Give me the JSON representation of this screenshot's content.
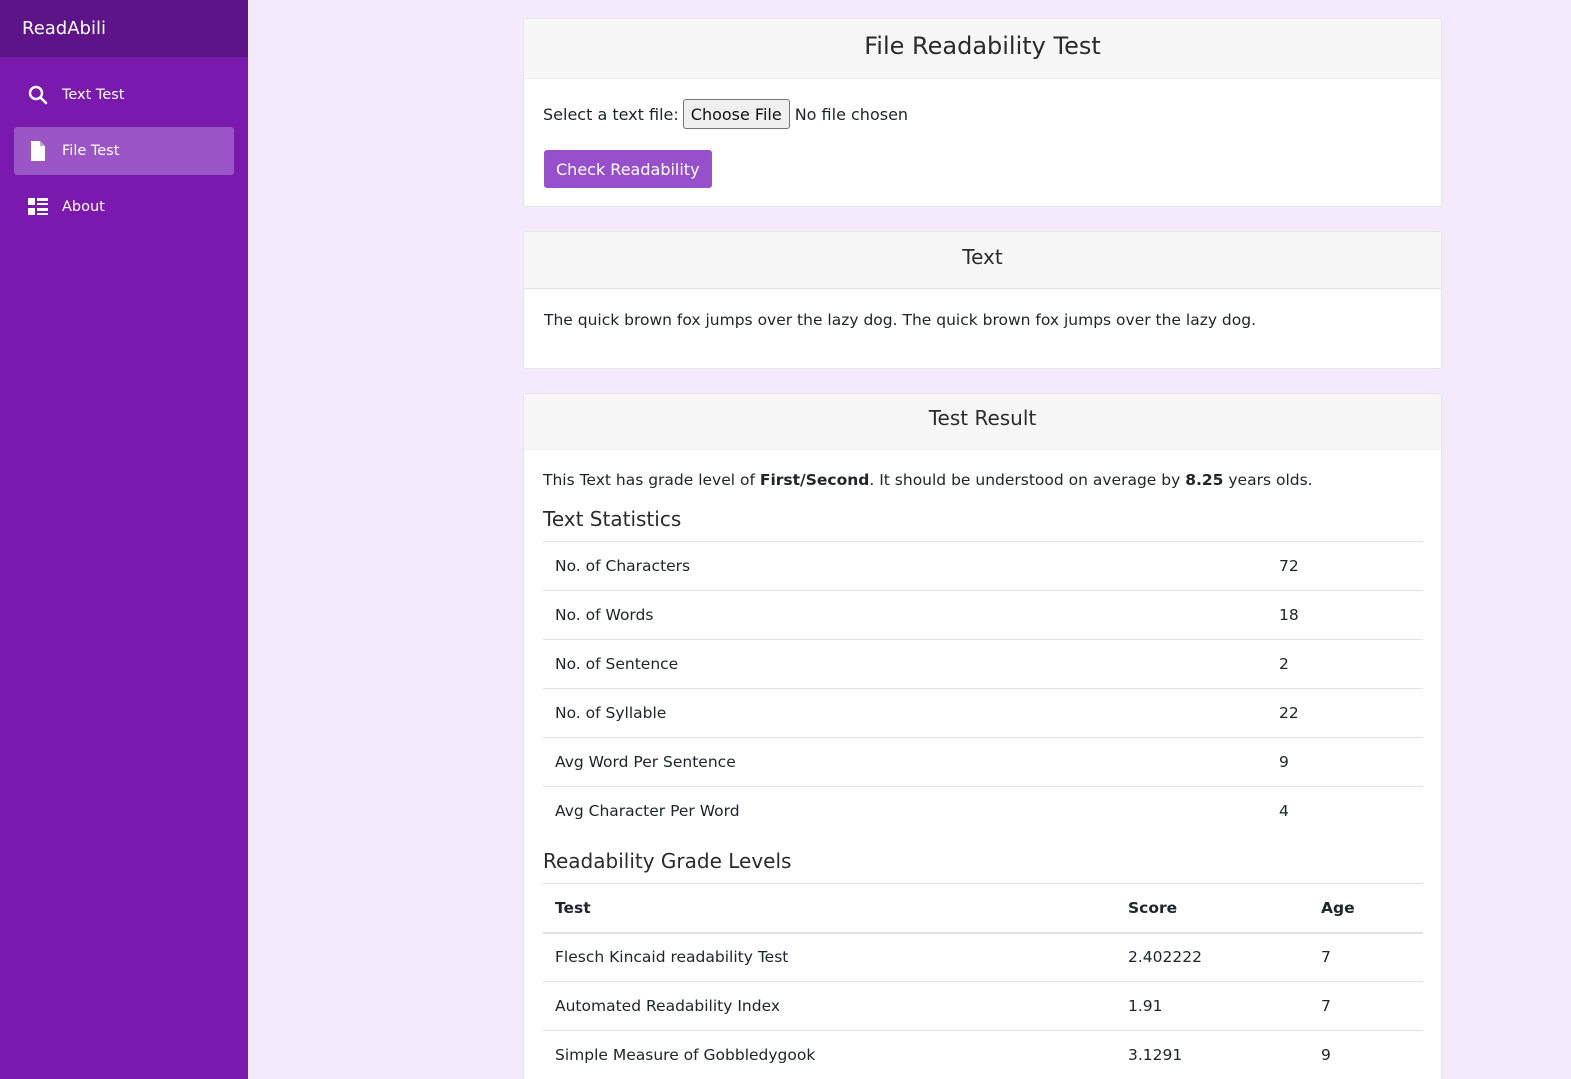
{
  "app": {
    "brand": "ReadAbili"
  },
  "sidebar": {
    "items": [
      {
        "label": "Text Test",
        "icon": "search-icon"
      },
      {
        "label": "File Test",
        "icon": "file-icon"
      },
      {
        "label": "About",
        "icon": "list-icon"
      }
    ]
  },
  "file_card": {
    "title": "File Readability Test",
    "select_label": "Select a text file:",
    "choose_button": "Choose File",
    "no_file": "No file chosen",
    "check_button": "Check Readability"
  },
  "text_card": {
    "title": "Text",
    "body": "The quick brown fox jumps over the lazy dog. The quick brown fox jumps over the lazy dog."
  },
  "result_card": {
    "title": "Test Result",
    "line_prefix": "This Text has grade level of ",
    "grade": "First/Second",
    "line_middle": ". It should be understood on average by ",
    "age": "8.25",
    "line_suffix": " years olds.",
    "stats_title": "Text Statistics",
    "stats": [
      {
        "label": "No. of Characters",
        "value": "72"
      },
      {
        "label": "No. of Words",
        "value": "18"
      },
      {
        "label": "No. of Sentence",
        "value": "2"
      },
      {
        "label": "No. of Syllable",
        "value": "22"
      },
      {
        "label": "Avg Word Per Sentence",
        "value": "9"
      },
      {
        "label": "Avg Character Per Word",
        "value": "4"
      }
    ],
    "grades_title": "Readability Grade Levels",
    "grades_headers": {
      "test": "Test",
      "score": "Score",
      "age": "Age"
    },
    "grades": [
      {
        "test": "Flesch Kincaid readability Test",
        "score": "2.402222",
        "age": "7"
      },
      {
        "test": "Automated Readability Index",
        "score": "1.91",
        "age": "7"
      },
      {
        "test": "Simple Measure of Gobbledygook",
        "score": "3.1291",
        "age": "9"
      }
    ]
  },
  "colors": {
    "sidebar": "#7a19ad",
    "brand_bar": "#5c1488",
    "active_item": "#9a55c6",
    "accent_button": "#9650cc",
    "page_bg": "#f3eafb"
  }
}
